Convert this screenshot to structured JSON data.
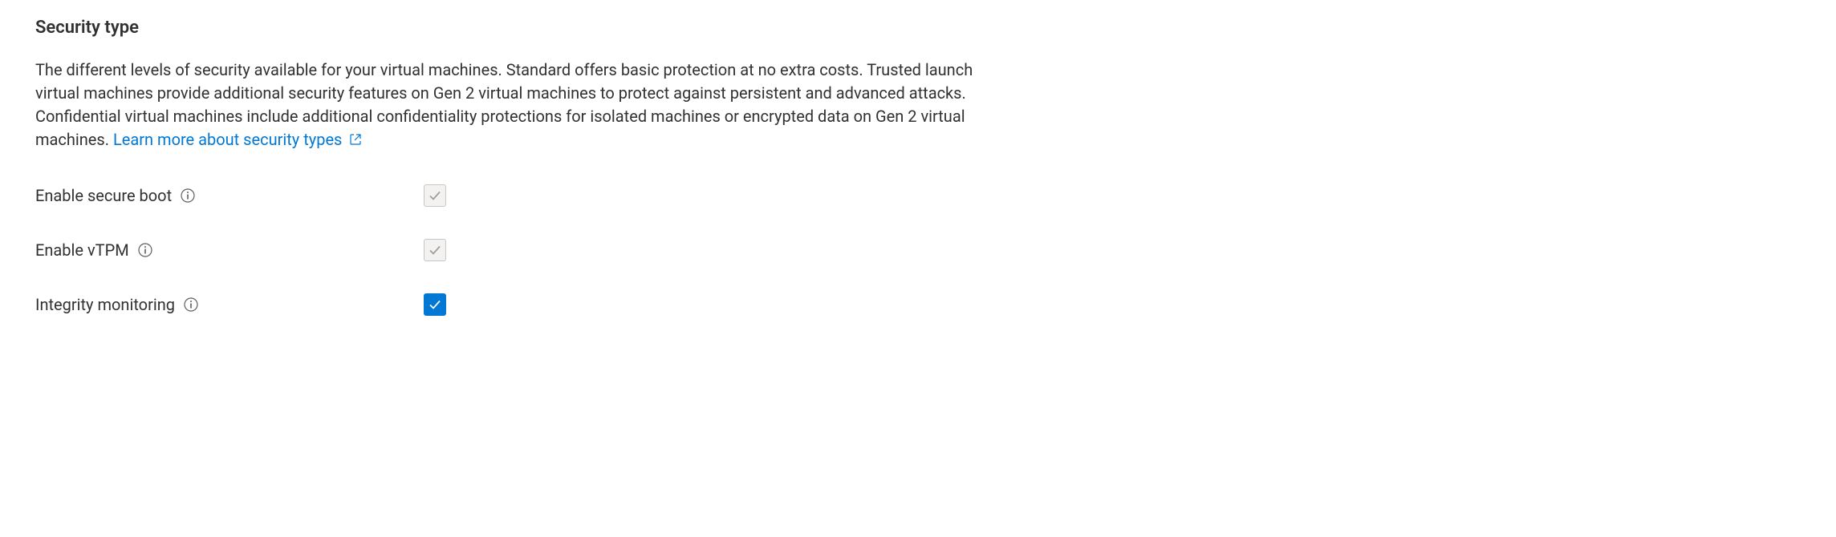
{
  "section": {
    "title": "Security type",
    "description": "The different levels of security available for your virtual machines. Standard offers basic protection at no extra costs. Trusted launch virtual machines provide additional security features on Gen 2 virtual machines to protect against persistent and advanced attacks. Confidential virtual machines include additional confidentiality protections for isolated machines or encrypted data on Gen 2 virtual machines.",
    "link_text": "Learn more about security types"
  },
  "fields": {
    "secure_boot": {
      "label": "Enable secure boot",
      "checked": true,
      "disabled": true
    },
    "vtpm": {
      "label": "Enable vTPM",
      "checked": true,
      "disabled": true
    },
    "integrity_monitoring": {
      "label": "Integrity monitoring",
      "checked": true,
      "disabled": false
    }
  },
  "colors": {
    "link": "#0078d4",
    "text": "#323130",
    "checkbox_active_bg": "#0078d4",
    "checkbox_disabled_bg": "#f3f2f1"
  }
}
